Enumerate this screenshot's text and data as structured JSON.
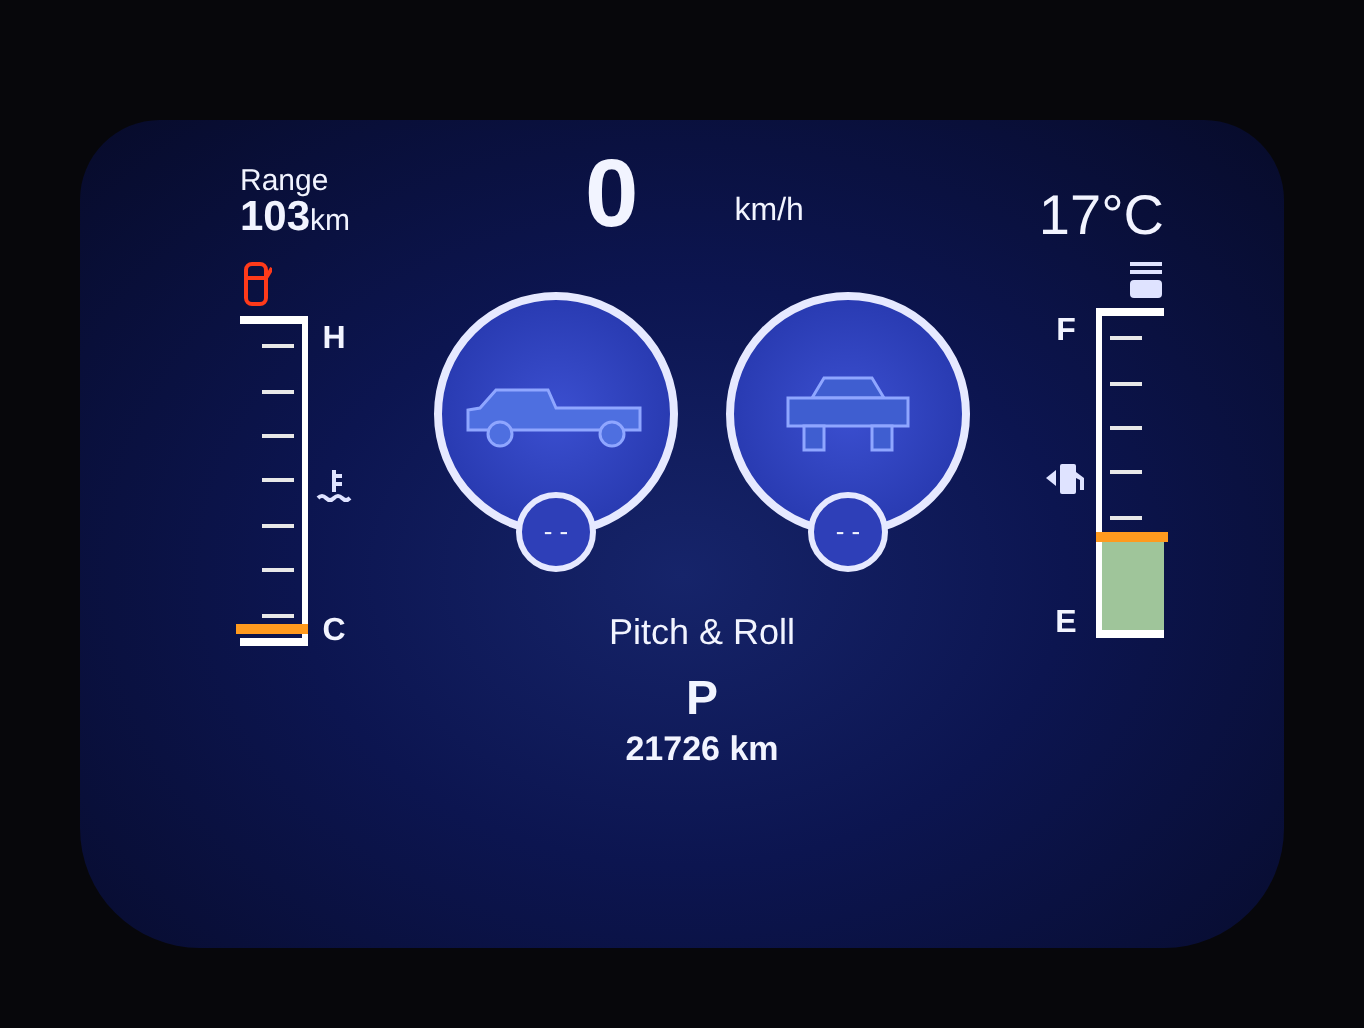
{
  "range": {
    "label": "Range",
    "value": "103",
    "unit": "km"
  },
  "speed": {
    "value": "0",
    "unit": "km/h"
  },
  "outside_temp": "17°C",
  "temp_gauge": {
    "top_label": "H",
    "bottom_label": "C",
    "level": 0.03
  },
  "fuel_gauge": {
    "top_label": "F",
    "bottom_label": "E",
    "level": 0.3
  },
  "inclinometers": [
    {
      "kind": "side",
      "reading": "- -"
    },
    {
      "kind": "rear",
      "reading": "- -"
    }
  ],
  "mode_title": "Pitch & Roll",
  "gear": "P",
  "odometer": "21726 km"
}
